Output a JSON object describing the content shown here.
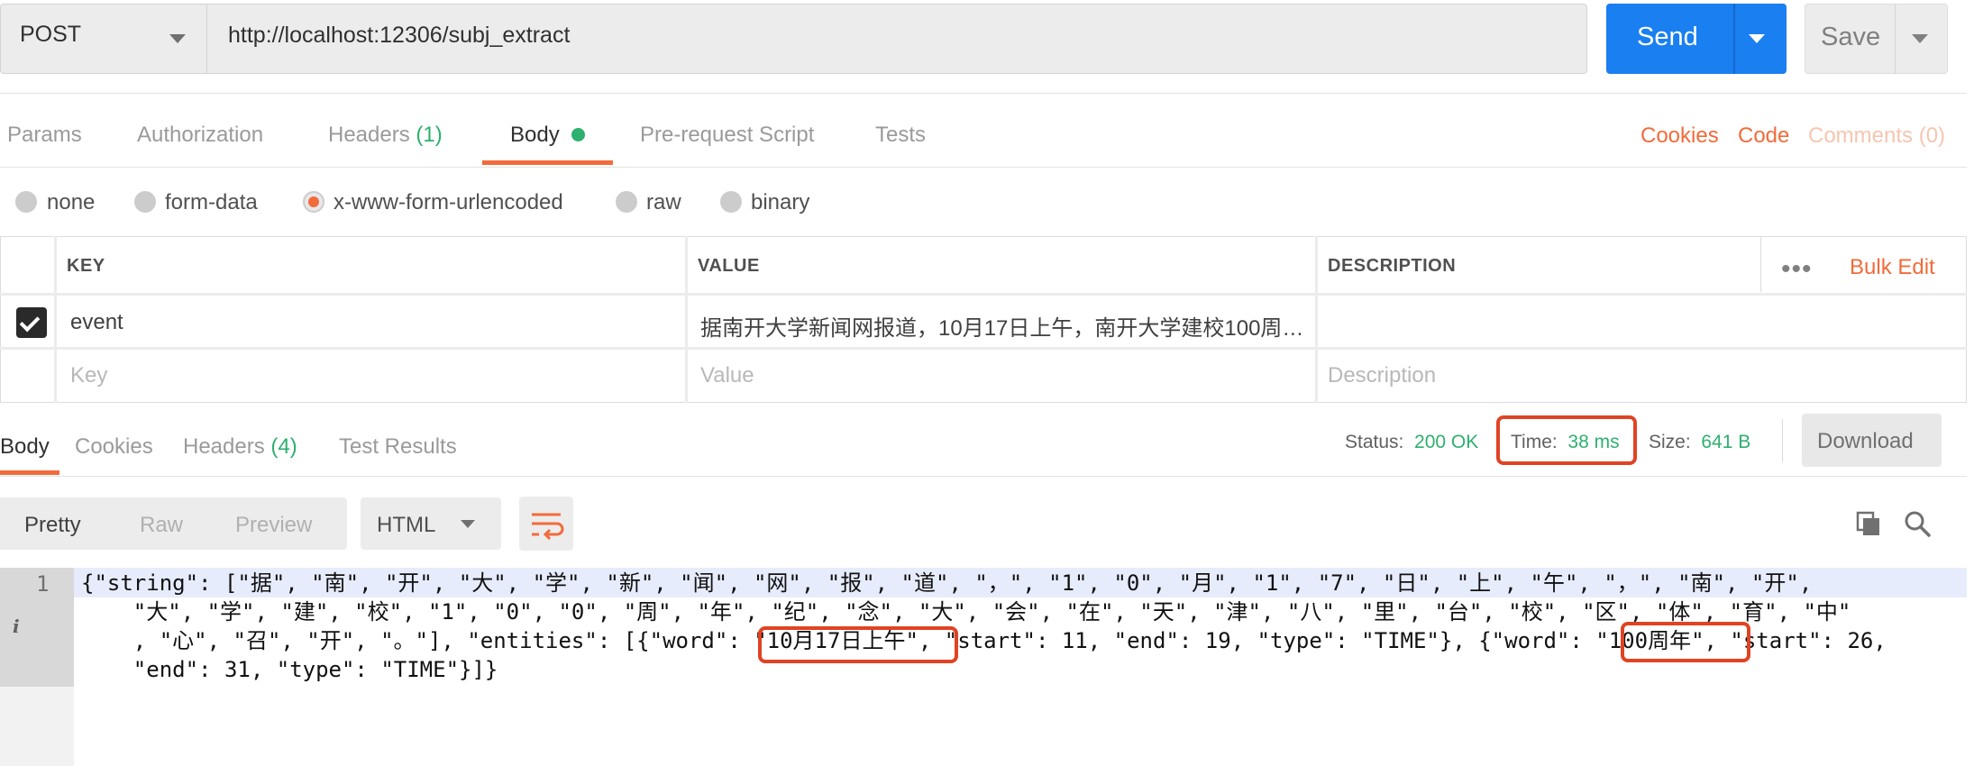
{
  "request": {
    "method": "POST",
    "url": "http://localhost:12306/subj_extract",
    "send_label": "Send",
    "save_label": "Save"
  },
  "request_tabs": {
    "params": "Params",
    "authorization": "Authorization",
    "headers": "Headers",
    "headers_count": "(1)",
    "body": "Body",
    "prerequest": "Pre-request Script",
    "tests": "Tests",
    "cookies": "Cookies",
    "code": "Code",
    "comments": "Comments (0)"
  },
  "body_types": {
    "none": "none",
    "form_data": "form-data",
    "urlencoded": "x-www-form-urlencoded",
    "raw": "raw",
    "binary": "binary",
    "selected": "x-www-form-urlencoded"
  },
  "params_table": {
    "headers": {
      "key": "KEY",
      "value": "VALUE",
      "description": "DESCRIPTION"
    },
    "bulk_edit": "Bulk Edit",
    "rows": [
      {
        "checked": true,
        "key": "event",
        "value": "据南开大学新闻网报道，10月17日上午，南开大学建校100周…",
        "description": ""
      }
    ],
    "placeholders": {
      "key": "Key",
      "value": "Value",
      "description": "Description"
    }
  },
  "response_tabs": {
    "body": "Body",
    "cookies": "Cookies",
    "headers": "Headers",
    "headers_count": "(4)",
    "test_results": "Test Results"
  },
  "response_meta": {
    "status_label": "Status:",
    "status_value": "200 OK",
    "time_label": "Time:",
    "time_value": "38 ms",
    "size_label": "Size:",
    "size_value": "641 B",
    "download": "Download"
  },
  "view": {
    "pretty": "Pretty",
    "raw": "Raw",
    "preview": "Preview",
    "language": "HTML"
  },
  "code": {
    "line_number": "1",
    "line1": "{\"string\": [\"据\", \"南\", \"开\", \"大\", \"学\", \"新\", \"闻\", \"网\", \"报\", \"道\", \"，\", \"1\", \"0\", \"月\", \"1\", \"7\", \"日\", \"上\", \"午\", \"，\", \"南\", \"开\",",
    "line2": "    \"大\", \"学\", \"建\", \"校\", \"1\", \"0\", \"0\", \"周\", \"年\", \"纪\", \"念\", \"大\", \"会\", \"在\", \"天\", \"津\", \"八\", \"里\", \"台\", \"校\", \"区\", \"体\", \"育\", \"中\"",
    "line3": "    , \"心\", \"召\", \"开\", \"。\"], \"entities\": [{\"word\": \"10月17日上午\", \"start\": 11, \"end\": 19, \"type\": \"TIME\"}, {\"word\": \"100周年\", \"start\": 26,",
    "line4": "    \"end\": 31, \"type\": \"TIME\"}]}"
  },
  "colors": {
    "accent": "#f26b3a",
    "send": "#1a7ff0",
    "success": "#2eb070",
    "highlight_box": "#e04323"
  }
}
